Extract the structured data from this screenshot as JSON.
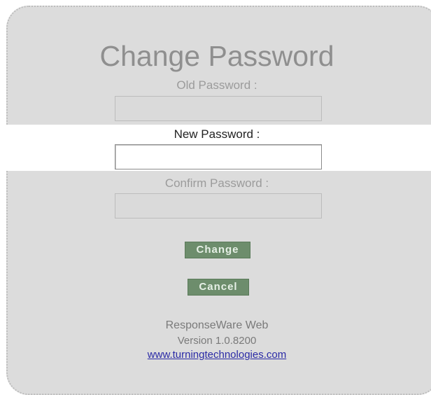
{
  "page": {
    "title": "Change Password"
  },
  "form": {
    "old_password": {
      "label": "Old Password :",
      "value": "",
      "placeholder": ""
    },
    "new_password": {
      "label": "New Password :",
      "value": "",
      "placeholder": ""
    },
    "confirm_password": {
      "label": "Confirm Password :",
      "value": "",
      "placeholder": ""
    }
  },
  "buttons": {
    "change_label": "Change",
    "cancel_label": "Cancel"
  },
  "footer": {
    "app_name": "ResponseWare Web",
    "version": "Version 1.0.8200",
    "link_text": "www.turningtechnologies.com"
  },
  "colors": {
    "panel_background": "#dcdcdc",
    "button_green": "#6d8d6c",
    "link_blue": "#2a2aa6",
    "active_band": "#ffffff"
  }
}
